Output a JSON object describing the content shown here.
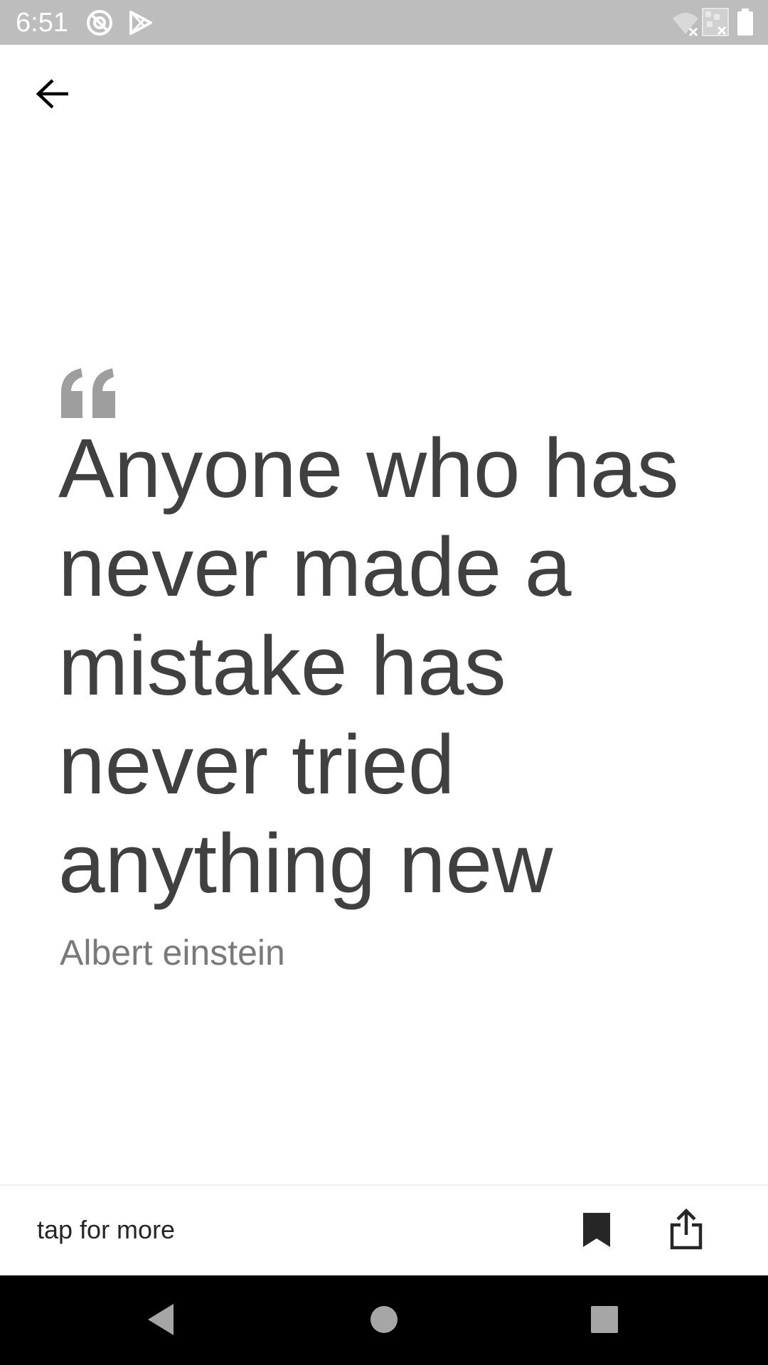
{
  "status_bar": {
    "time": "6:51",
    "icons": [
      "at-sign-icon",
      "play-store-icon",
      "wifi-off-icon",
      "no-sim-icon",
      "battery-icon"
    ]
  },
  "app_bar": {
    "back_icon": "arrow-back-icon"
  },
  "quote": {
    "mark_icon": "quote-mark-icon",
    "text": "Anyone who has never made a mistake has never tried anything new",
    "author": "Albert einstein"
  },
  "bottom_bar": {
    "tap_label": "tap for more",
    "bookmark_icon": "bookmark-icon",
    "share_icon": "share-icon"
  },
  "nav_bar": {
    "back": "nav-back-icon",
    "home": "nav-home-icon",
    "recents": "nav-recents-icon"
  },
  "colors": {
    "status_bar": "#bdbdbd",
    "quote_text": "#404040",
    "author_text": "#7a7a7a",
    "quote_mark": "#9e9e9e",
    "nav_bar": "#000000"
  }
}
